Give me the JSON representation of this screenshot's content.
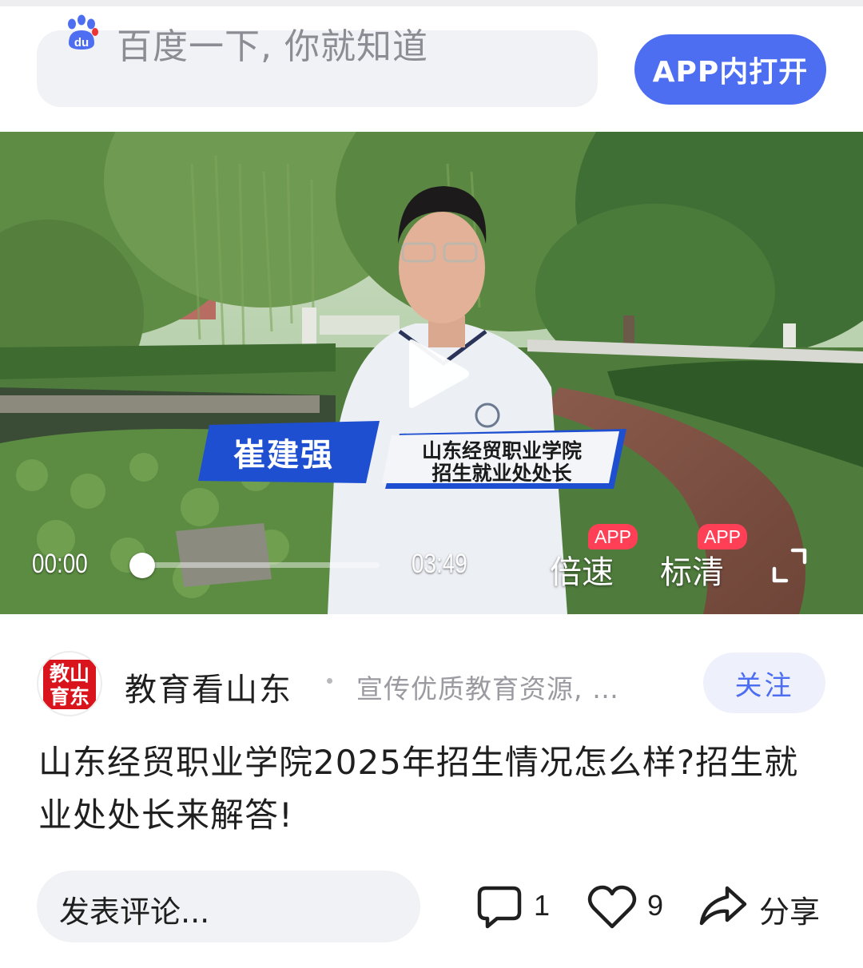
{
  "header": {
    "search_placeholder": "百度一下, 你就知道",
    "search_logo_text": "du",
    "open_app_label": "APP内打开",
    "accent_color": "#4e6ef2"
  },
  "video": {
    "current_time": "00:00",
    "duration": "03:49",
    "progress": 0,
    "speed_label": "倍速",
    "quality_label": "标清",
    "app_badge": "APP",
    "caption_name": "崔建强",
    "caption_title_line1": "山东经贸职业学院",
    "caption_title_line2": "招生就业处处长",
    "icons": [
      "play-icon",
      "fullscreen-icon"
    ]
  },
  "author": {
    "avatar_text_line1": "教山",
    "avatar_text_line2": "育东",
    "name": "教育看山东",
    "description": "宣传优质教育资源, …",
    "follow_label": "关注"
  },
  "post": {
    "headline": "山东经贸职业学院2025年招生情况怎么样?招生就业处处长来解答!"
  },
  "actions": {
    "comment_placeholder": "发表评论...",
    "comment_count": "1",
    "like_count": "9",
    "share_label": "分享",
    "icons": [
      "comment-icon",
      "heart-icon",
      "share-icon"
    ]
  }
}
